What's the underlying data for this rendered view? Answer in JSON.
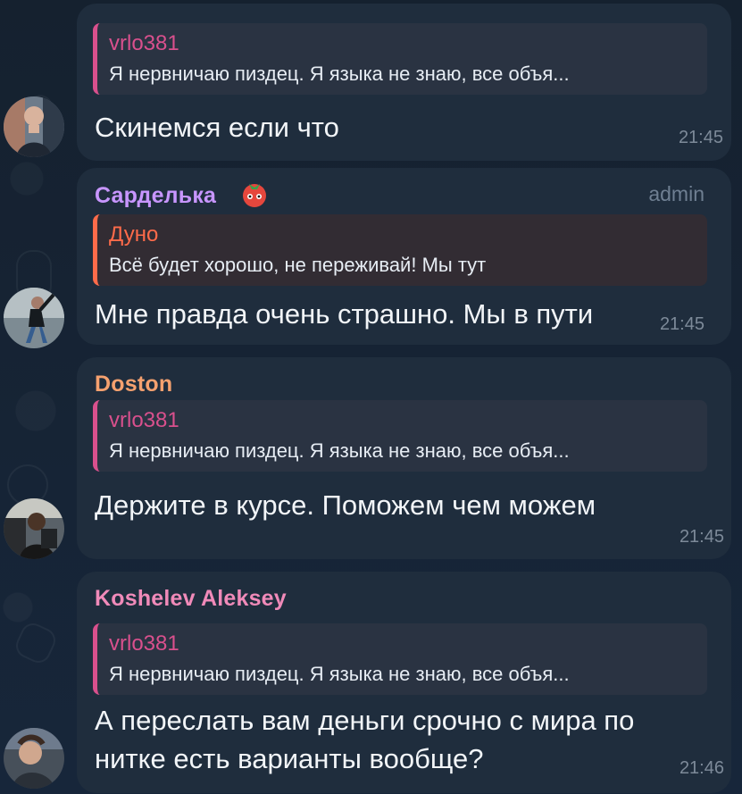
{
  "messages": [
    {
      "reply": {
        "author": "vrlo381",
        "text": "Я нервничаю пиздец. Я языка не знаю, все объя..."
      },
      "text": "Скинемся если что",
      "time": "21:45"
    },
    {
      "sender": "Сарделька",
      "sender_emoji": "tomato-emoji",
      "admin_label": "admin",
      "reply": {
        "author": "Дуно",
        "text": "Всё будет хорошо, не переживай! Мы тут"
      },
      "text": "Мне правда очень страшно. Мы в пути",
      "time": "21:45"
    },
    {
      "sender": "Doston",
      "reply": {
        "author": "vrlo381",
        "text": "Я нервничаю пиздец. Я языка не знаю, все объя..."
      },
      "text": "Держите в курсе. Поможем чем можем",
      "time": "21:45"
    },
    {
      "sender": "Koshelev Aleksey",
      "reply": {
        "author": "vrlo381",
        "text": "Я нервничаю пиздец. Я языка не знаю, все объя..."
      },
      "text_lines": [
        "А переслать вам деньги срочно с мира по",
        "нитке есть варианты вообще?"
      ],
      "time": "21:46"
    }
  ],
  "colors": {
    "background": "#152331",
    "bubble": "#1f2d3d",
    "reply_bg": "#2a3342",
    "reply_accent": "#d9508d",
    "sender_sardelka": "#c896ff",
    "sender_doston": "#f5a16f",
    "sender_koshelev": "#f08ab9"
  }
}
